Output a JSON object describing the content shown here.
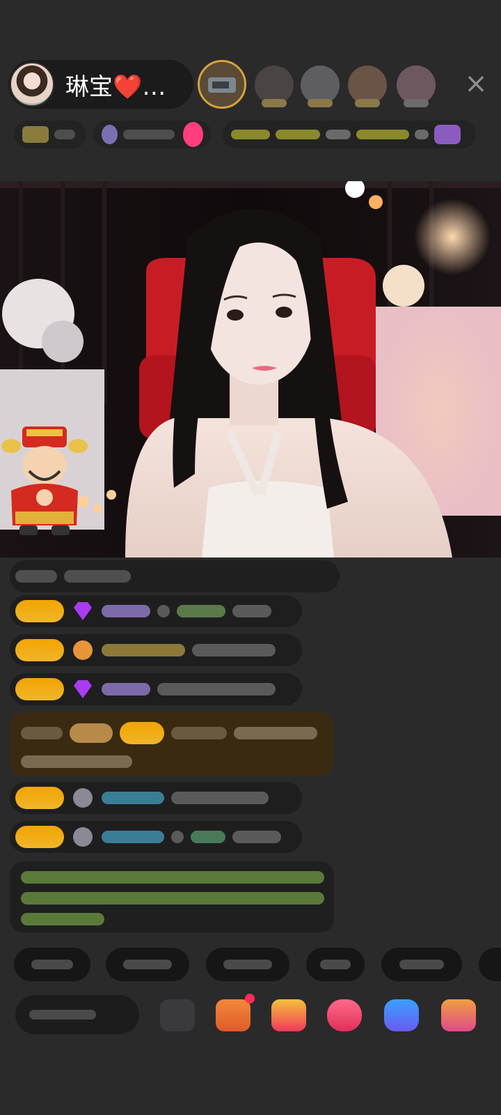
{
  "header": {
    "host_name": "琳宝❤️…",
    "close_icon": "×"
  },
  "colors": {
    "background": "#2a2a2b",
    "pill": "#1b1b1c",
    "level_badge": "#f2a400",
    "accent_pink": "#ff3d7f",
    "notice_green": "#8fc75e"
  },
  "icons": [
    "host-avatar",
    "viewer-avatar",
    "close-icon",
    "diamond-icon",
    "fan-badge-icon",
    "mascot-sticker",
    "emoji-icon",
    "gift-icon"
  ]
}
